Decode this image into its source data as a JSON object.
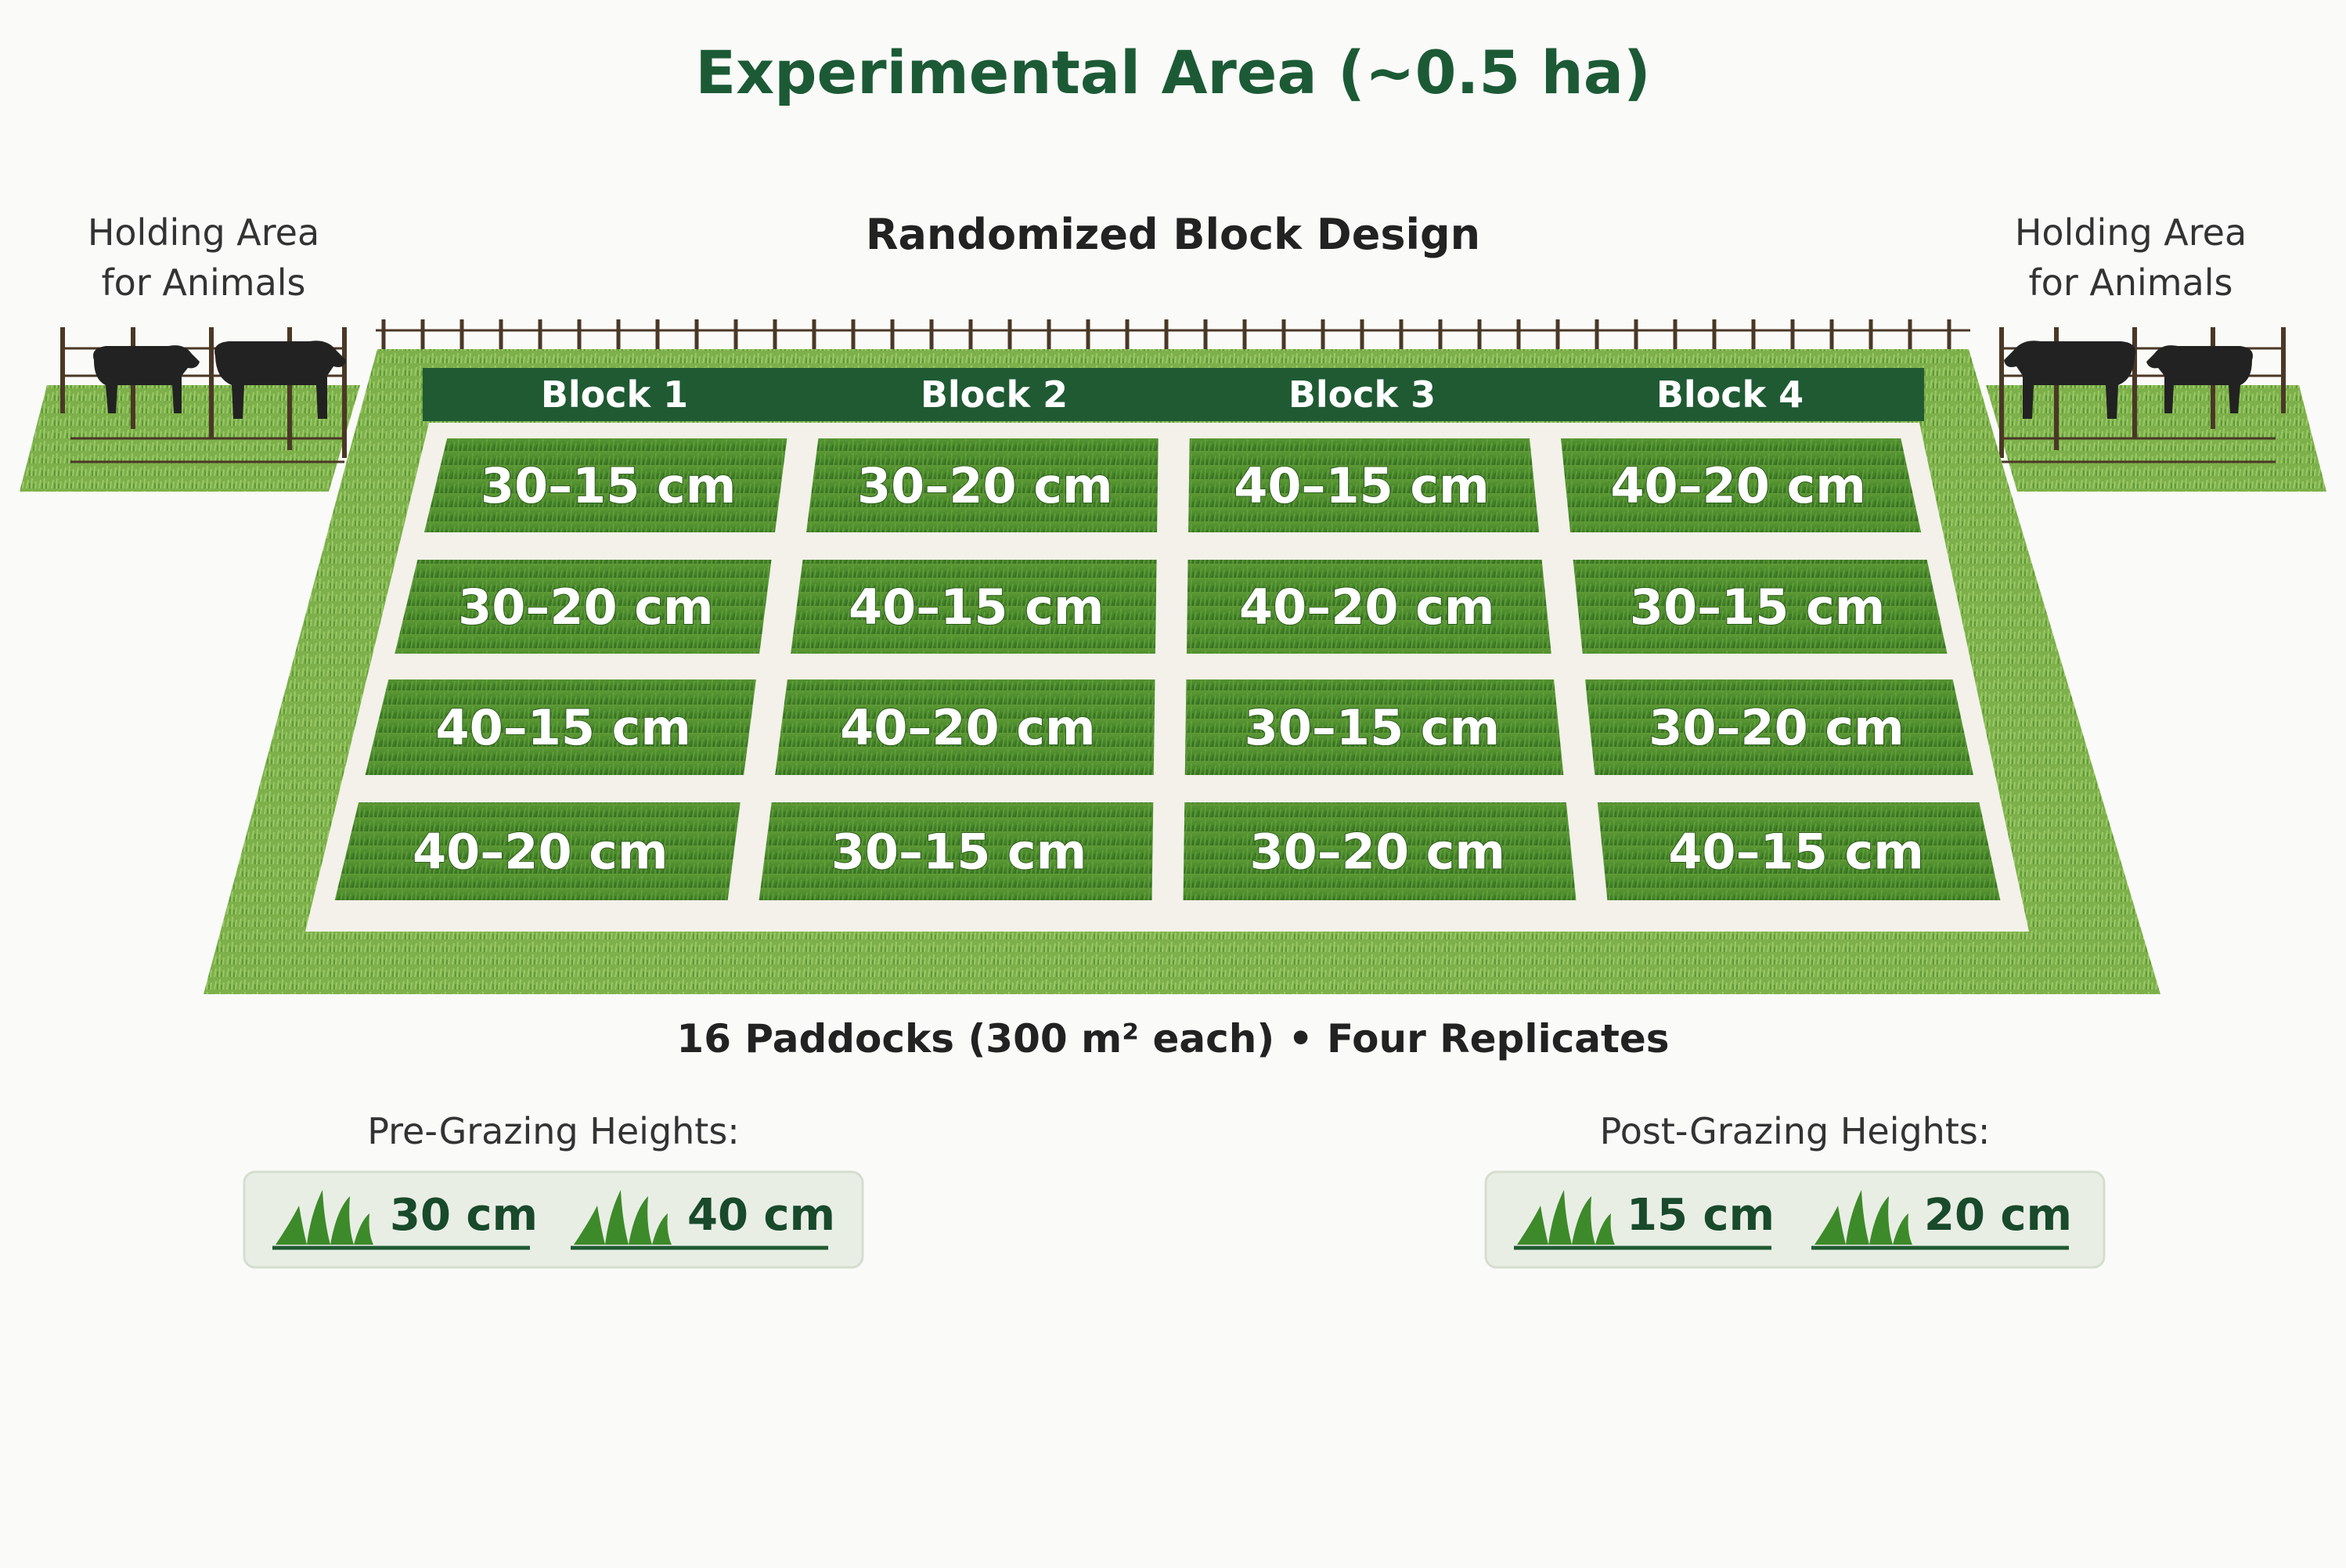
{
  "title": "Experimental Area (~0.5 ha)",
  "subtitle": "Randomized Block Design",
  "holding_left": {
    "line1": "Holding Area",
    "line2": "for Animals"
  },
  "holding_right": {
    "line1": "Holding Area",
    "line2": "for Animals"
  },
  "blocks": [
    "Block 1",
    "Block 2",
    "Block 3",
    "Block 4"
  ],
  "paddocks": [
    [
      "30–15 cm",
      "30–20 cm",
      "40–15 cm",
      "40–20 cm"
    ],
    [
      "30–20 cm",
      "40–15 cm",
      "40–20 cm",
      "30–15 cm"
    ],
    [
      "40–15 cm",
      "40–20 cm",
      "30–15 cm",
      "30–20 cm"
    ],
    [
      "40–20 cm",
      "30–15 cm",
      "30–20 cm",
      "40–15 cm"
    ]
  ],
  "caption": "16 Paddocks (300 m² each) • Four Replicates",
  "pre_grazing": {
    "title": "Pre-Grazing Heights:",
    "items": [
      "30 cm",
      "40 cm"
    ]
  },
  "post_grazing": {
    "title": "Post-Grazing Heights:",
    "items": [
      "15 cm",
      "20 cm"
    ]
  },
  "colors": {
    "title": "#1c5a36",
    "header_band": "#1f5a33",
    "grass_dark": "#3f7d28",
    "grass_light": "#7fb54a",
    "path": "#f3f1ea"
  }
}
